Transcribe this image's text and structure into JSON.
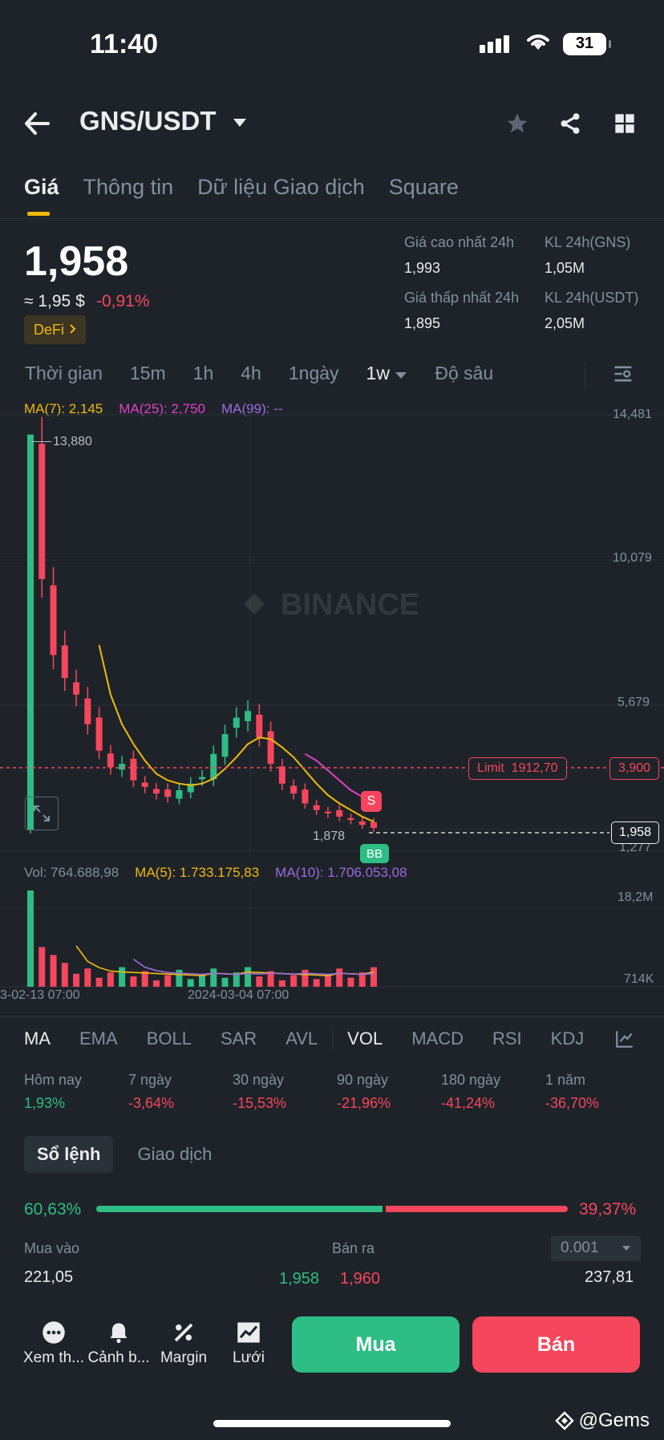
{
  "status": {
    "time": "11:40",
    "battery": "31"
  },
  "header": {
    "pair": "GNS/USDT"
  },
  "tabs": [
    "Giá",
    "Thông tin",
    "Dữ liệu Giao dịch",
    "Square"
  ],
  "price": {
    "last": "1,958",
    "usd": "≈ 1,95 $",
    "change": "-0,91%",
    "tag": "DeFi",
    "stats": {
      "high_label": "Giá cao nhất 24h",
      "high": "1,993",
      "low_label": "Giá thấp nhất 24h",
      "low": "1,895",
      "vol_gns_label": "KL 24h(GNS)",
      "vol_gns": "1,05M",
      "vol_usdt_label": "KL 24h(USDT)",
      "vol_usdt": "2,05M"
    }
  },
  "timeframes": {
    "items": [
      "Thời gian",
      "15m",
      "1h",
      "4h",
      "1ngày",
      "1w",
      "Độ sâu"
    ],
    "selected": "1w"
  },
  "ma_legend": {
    "ma7": "MA(7): 2,145",
    "ma25": "MA(25): 2,750",
    "ma99": "MA(99): --"
  },
  "colors": {
    "up": "#2ebd85",
    "down": "#f6465d",
    "accent": "#f0b90b",
    "ma7": "#f0b90b",
    "ma25": "#e040c8",
    "ma99": "#9c6be0",
    "bg": "#1e2329"
  },
  "chart_axes": {
    "price_ticks": [
      "14,481",
      "10,079",
      "5,679",
      "1,277"
    ],
    "vol_ticks": [
      "18,2M",
      "714K"
    ],
    "dates": [
      "3-02-13 07:00",
      "2024-03-04 07:00"
    ],
    "high_label": "13,880",
    "low_label": "1,878",
    "limit_label": "Limit  1912,70",
    "limit_price": "3,900",
    "current_price": "1,958",
    "sell_marker": "S",
    "buy_marker": "BB",
    "watermark": "BINANCE"
  },
  "vol_legend": {
    "vol": "Vol: 764.688,98",
    "ma5": "MA(5): 1.733.175,83",
    "ma10": "MA(10): 1.706.053,08"
  },
  "chart_data": {
    "type": "candlestick",
    "interval": "1w",
    "ylim": [
      1277,
      14481
    ],
    "high": 13880,
    "low": 1878,
    "last": 1958,
    "candles_close": [
      13880,
      9500,
      7200,
      6500,
      6000,
      5100,
      4300,
      3800,
      3900,
      3400,
      3200,
      3000,
      2900,
      3100,
      3300,
      3500,
      4200,
      4800,
      5300,
      5500,
      4700,
      3900,
      3300,
      3000,
      2700,
      2500,
      2400,
      2300,
      2200,
      2050,
      1958
    ],
    "series": [
      {
        "name": "MA(7)",
        "values": [
          null,
          null,
          null,
          null,
          null,
          null,
          7500,
          6000,
          5100,
          4500,
          4000,
          3600,
          3400,
          3300,
          3250,
          3300,
          3450,
          3750,
          4100,
          4500,
          4700,
          4650,
          4400,
          4100,
          3700,
          3300,
          2950,
          2700,
          2500,
          2300,
          2145
        ]
      },
      {
        "name": "MA(25)",
        "values": [
          null,
          null,
          null,
          null,
          null,
          null,
          null,
          null,
          null,
          null,
          null,
          null,
          null,
          null,
          null,
          null,
          null,
          null,
          null,
          null,
          null,
          null,
          null,
          null,
          4200,
          4000,
          3700,
          3400,
          3100,
          2900,
          2750
        ]
      }
    ],
    "volume_ylim": [
      0,
      18200000
    ]
  },
  "indicators": {
    "items": [
      "MA",
      "EMA",
      "BOLL",
      "SAR",
      "AVL",
      "VOL",
      "MACD",
      "RSI",
      "KDJ"
    ],
    "selected": [
      "MA",
      "VOL"
    ]
  },
  "performance": [
    {
      "label": "Hôm nay",
      "value": "1,93%"
    },
    {
      "label": "7 ngày",
      "value": "-3,64%"
    },
    {
      "label": "30 ngày",
      "value": "-15,53%"
    },
    {
      "label": "90 ngày",
      "value": "-21,96%"
    },
    {
      "label": "180 ngày",
      "value": "-41,24%"
    },
    {
      "label": "1 năm",
      "value": "-36,70%"
    }
  ],
  "orderbook": {
    "tabs": [
      "Sổ lệnh",
      "Giao dịch"
    ],
    "buy_pct": "60,63%",
    "sell_pct": "39,37%",
    "buy_fraction": 0.6063,
    "buy_label": "Mua vào",
    "sell_label": "Bán ra",
    "precision": "0.001",
    "bid_qty": "221,05",
    "bid_price": "1,958",
    "ask_price": "1,960",
    "ask_qty": "237,81"
  },
  "bottom_nav": {
    "items": [
      "Xem th...",
      "Cảnh b...",
      "Margin",
      "Lưới"
    ],
    "buy": "Mua",
    "sell": "Bán"
  },
  "watermark": "@Gems"
}
